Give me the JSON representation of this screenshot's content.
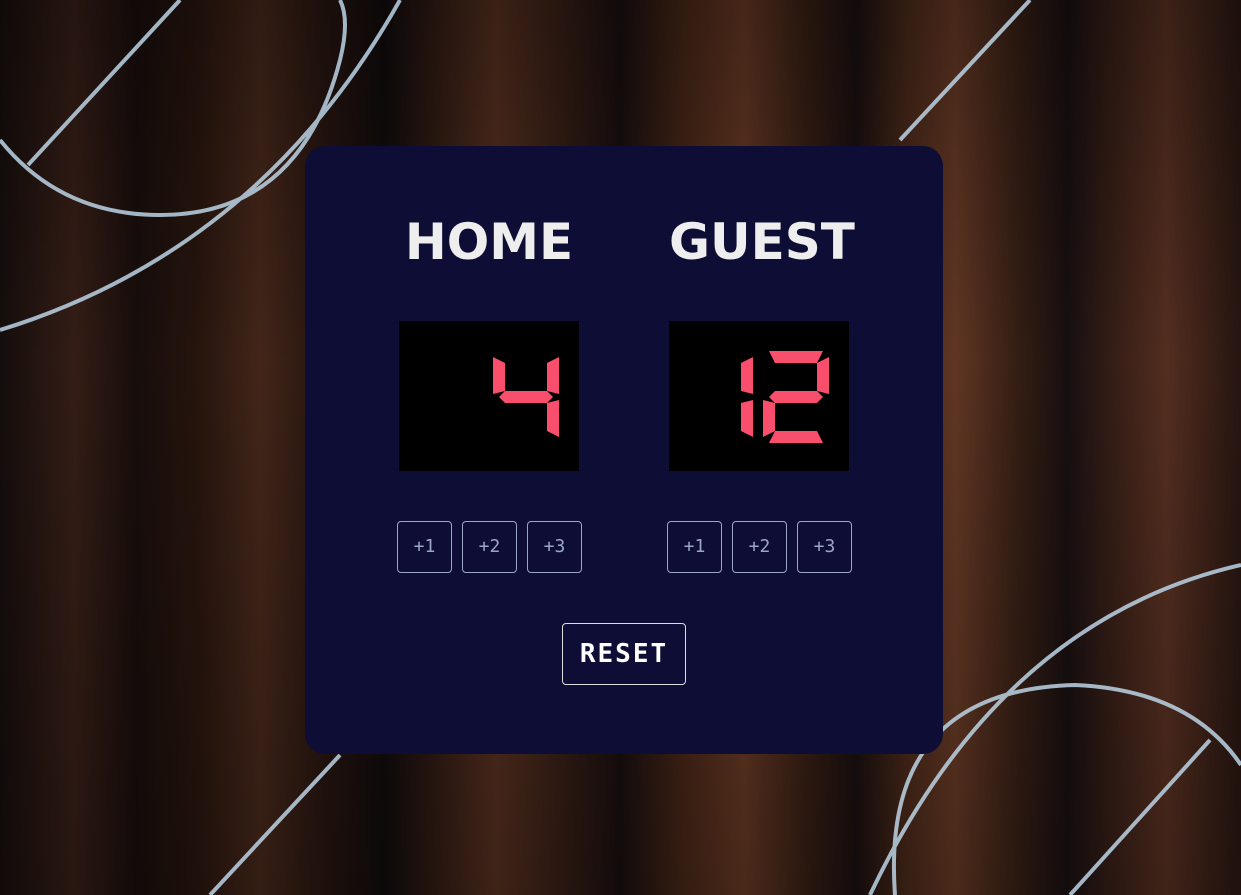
{
  "home": {
    "title": "HOME",
    "score": "4",
    "buttons": [
      "+1",
      "+2",
      "+3"
    ]
  },
  "guest": {
    "title": "GUEST",
    "score": "12",
    "buttons": [
      "+1",
      "+2",
      "+3"
    ]
  },
  "reset_label": "RESET",
  "colors": {
    "card": "#0d0d35",
    "digit": "#f94f6d",
    "title": "#eeeeee",
    "button_border": "#9aa7c4"
  }
}
